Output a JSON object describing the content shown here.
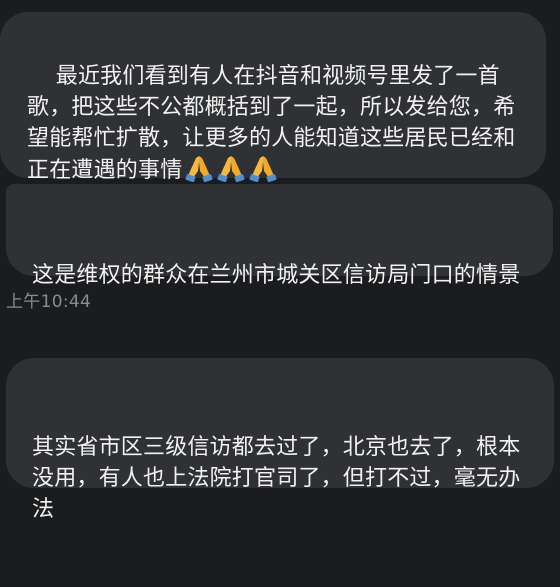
{
  "messages": [
    {
      "text": "最近我们看到有人在抖音和视频号里发了一首歌，把这些不公都概括到了一起，所以发给您，希望能帮忙扩散，让更多的人能知道这些居民已经和正在遭遇的事情",
      "emojis": [
        "pray-icon",
        "pray-icon",
        "pray-icon"
      ]
    },
    {
      "text": "这是维权的群众在兰州市城关区信访局门口的情景"
    },
    {
      "text": "其实省市区三级信访都去过了，北京也去了，根本没用，有人也上法院打官司了，但打不过，毫无办法"
    }
  ],
  "timestamp": "上午10:44",
  "colors": {
    "background": "#1b1c1e",
    "bubble": "#2f3134",
    "text": "#f2f2f2",
    "timestamp": "#8a8b8e",
    "emoji_hands": "#f5b83d",
    "emoji_sleeve": "#4a90d9"
  }
}
